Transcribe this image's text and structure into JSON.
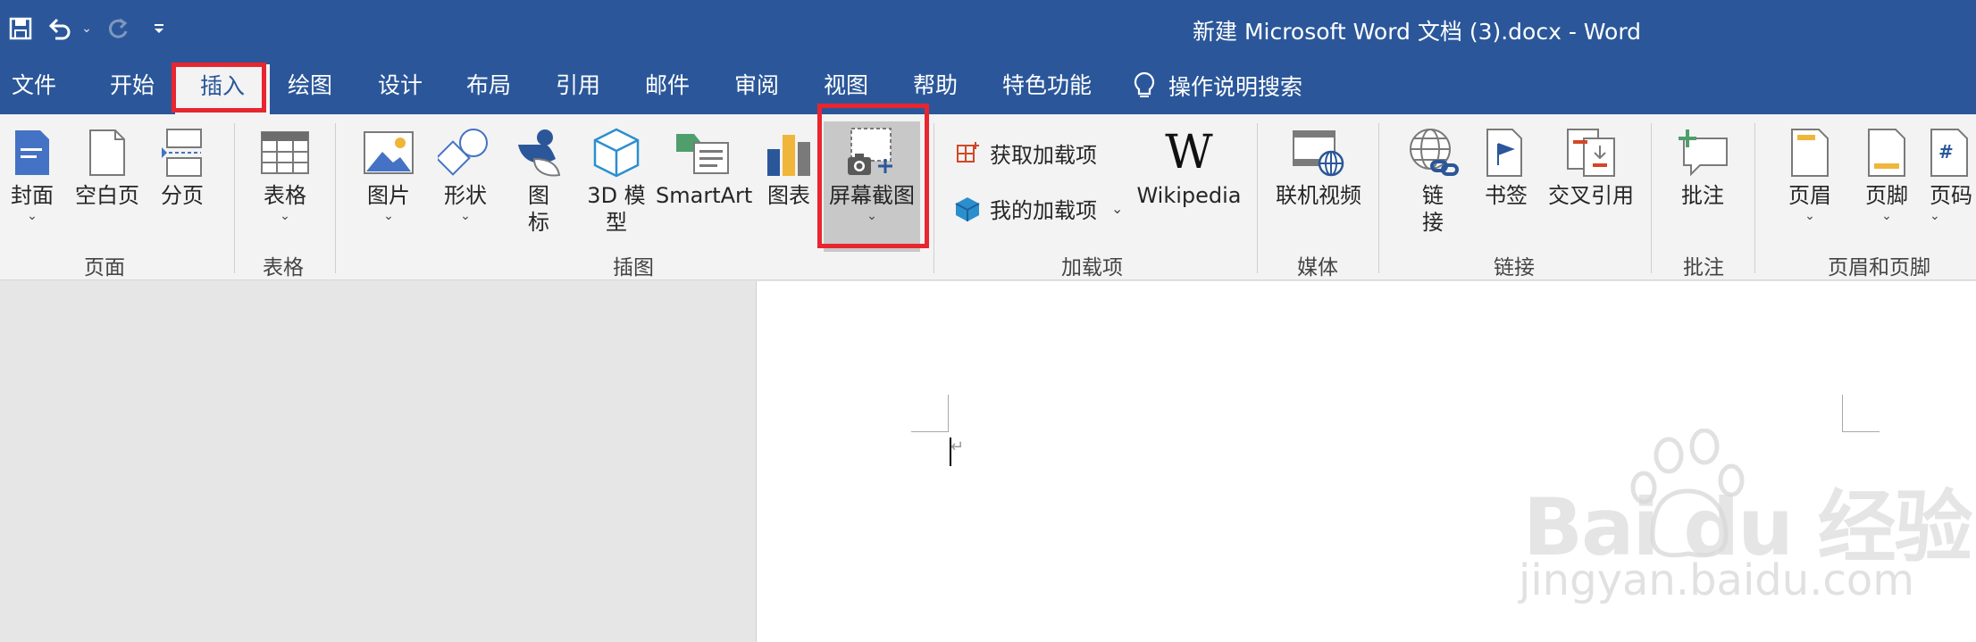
{
  "window": {
    "title": "新建 Microsoft Word 文档 (3).docx  -  Word"
  },
  "qat": {
    "more": "⌄",
    "dropdown": "⌄"
  },
  "tabs": [
    {
      "label": "文件"
    },
    {
      "label": "开始"
    },
    {
      "label": "插入"
    },
    {
      "label": "绘图"
    },
    {
      "label": "设计"
    },
    {
      "label": "布局"
    },
    {
      "label": "引用"
    },
    {
      "label": "邮件"
    },
    {
      "label": "审阅"
    },
    {
      "label": "视图"
    },
    {
      "label": "帮助"
    },
    {
      "label": "特色功能"
    }
  ],
  "tell_me": "操作说明搜索",
  "ribbon": {
    "pages": {
      "cover": "封面",
      "blank": "空白页",
      "break": "分页",
      "group": "页面"
    },
    "tables": {
      "table": "表格",
      "group": "表格"
    },
    "illustrations": {
      "pictures": "图片",
      "shapes": "形状",
      "icons_1": "图",
      "icons_2": "标",
      "model_1": "3D 模",
      "model_2": "型",
      "smartart": "SmartArt",
      "chart": "图表",
      "screenshot": "屏幕截图",
      "group": "插图"
    },
    "addins": {
      "get": "获取加载项",
      "my": "我的加载项",
      "wikipedia": "Wikipedia",
      "wiki_glyph": "W",
      "group": "加载项"
    },
    "media": {
      "video": "联机视频",
      "group": "媒体"
    },
    "links": {
      "link_1": "链",
      "link_2": "接",
      "bookmark": "书签",
      "crossref": "交叉引用",
      "group": "链接"
    },
    "comments": {
      "comment": "批注",
      "group": "批注"
    },
    "headerfooter": {
      "header": "页眉",
      "footer": "页脚",
      "pagenum": "页码",
      "group": "页眉和页脚"
    },
    "dropdown_glyph": "⌄"
  },
  "document": {
    "paragraph_mark": "↵"
  },
  "watermark": {
    "text": "Bai du 经验",
    "sub": "jingyan.baidu.com"
  },
  "colors": {
    "brand": "#2b579a",
    "highlight": "#e8262f",
    "ribbon": "#f3f3f3"
  }
}
